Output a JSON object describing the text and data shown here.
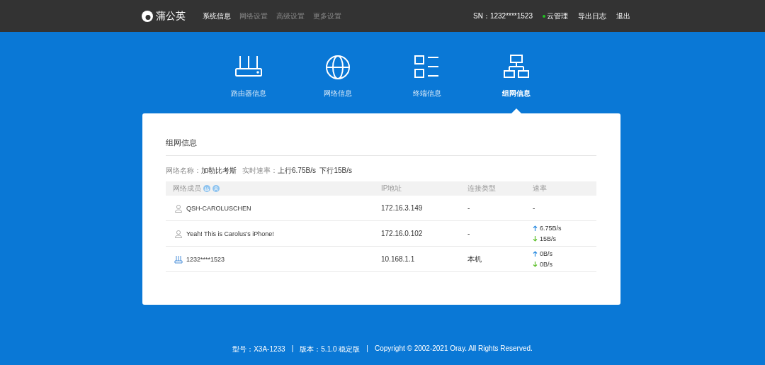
{
  "header": {
    "logo": "蒲公英",
    "menu": [
      {
        "label": "系统信息",
        "selected": true
      },
      {
        "label": "网络设置",
        "selected": false
      },
      {
        "label": "高级设置",
        "selected": false
      },
      {
        "label": "更多设置",
        "selected": false
      }
    ],
    "sn": "SN：1232****1523",
    "cloud": {
      "label": "云管理",
      "online": true
    },
    "links": [
      "导出日志",
      "退出"
    ]
  },
  "tabs": [
    {
      "label": "路由器信息",
      "selected": false
    },
    {
      "label": "网络信息",
      "selected": false
    },
    {
      "label": "终端信息",
      "selected": false
    },
    {
      "label": "组网信息",
      "selected": true
    }
  ],
  "card": {
    "title": "组网信息",
    "info": [
      {
        "label": "网络名称：",
        "value": "加勒比考斯"
      },
      {
        "label": "实时速率：",
        "value": "上行6.75B/s  下行15B/s"
      }
    ],
    "columns": [
      "网络成员",
      "IP地址",
      "连接类型",
      "速率"
    ],
    "rows": [
      {
        "kind": "user",
        "name": "QSH-CAROLUSCHEN",
        "ip": "172.16.3.149",
        "type": "-",
        "rate": "-"
      },
      {
        "kind": "user",
        "name": "Yeah! This is Carolus's iPhone!",
        "ip": "172.16.0.102",
        "type": "-",
        "up": "6.75B/s",
        "down": "15B/s"
      },
      {
        "kind": "router",
        "name": "1232****1523",
        "ip": "10.168.1.1",
        "type": "本机",
        "up": "0B/s",
        "down": "0B/s"
      }
    ]
  },
  "footer": [
    "型号：X3A-1233",
    "|",
    "版本：5.1.0 稳定版",
    "|",
    "Copyright © 2002-2021 Oray. All Rights Reserved."
  ]
}
